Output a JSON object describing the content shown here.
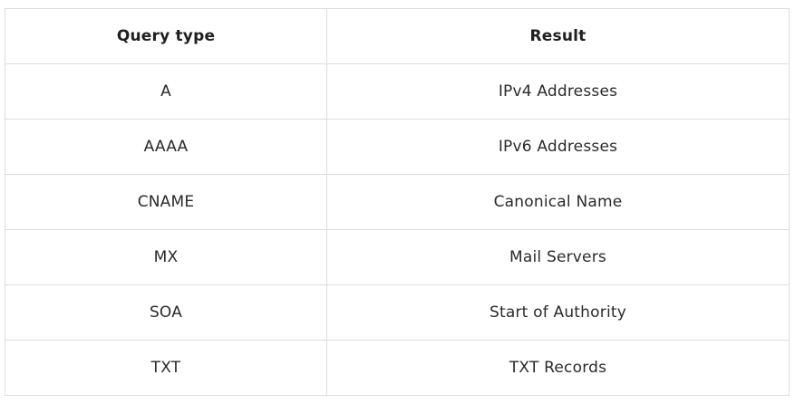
{
  "table": {
    "headers": [
      "Query type",
      "Result"
    ],
    "rows": [
      {
        "type": "A",
        "result": "IPv4 Addresses"
      },
      {
        "type": "AAAA",
        "result": "IPv6 Addresses"
      },
      {
        "type": "CNAME",
        "result": "Canonical Name"
      },
      {
        "type": "MX",
        "result": "Mail Servers"
      },
      {
        "type": "SOA",
        "result": "Start of Authority"
      },
      {
        "type": "TXT",
        "result": "TXT Records"
      }
    ]
  }
}
